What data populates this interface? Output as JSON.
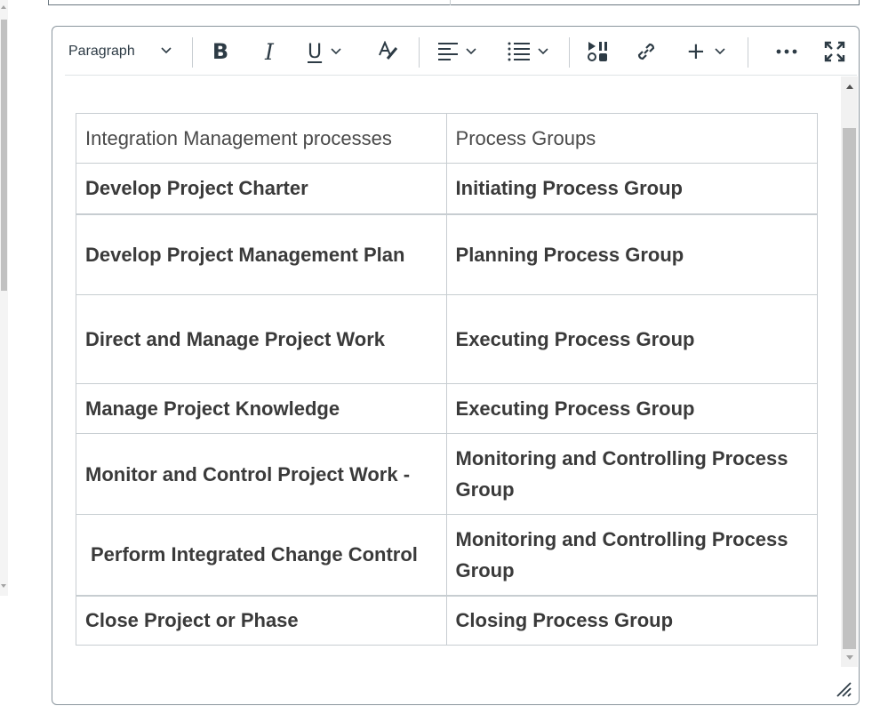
{
  "toolbar": {
    "block_format": "Paragraph",
    "icons": {
      "chevron": "chevron-down-icon",
      "bold": "bold-icon",
      "italic": "italic-icon",
      "underline": "underline-icon",
      "text_color": "text-color-icon",
      "align": "align-left-icon",
      "list": "bulleted-list-icon",
      "media": "media-icon",
      "link": "link-icon",
      "insert": "plus-icon",
      "more": "more-icon",
      "fullscreen": "fullscreen-icon"
    },
    "labels": {
      "bold": "B",
      "italic": "I",
      "underline": "U",
      "plus": "+",
      "more": "•••"
    }
  },
  "table": {
    "header": [
      "Integration Management processes",
      "Process Groups"
    ],
    "rows": [
      [
        "Develop Project Charter",
        "Initiating Process Group"
      ],
      [
        "Develop Project Management Plan",
        "Planning Process Group"
      ],
      [
        "Direct and Manage Project Work",
        "Executing Process Group"
      ],
      [
        "Manage Project Knowledge",
        "Executing Process Group"
      ],
      [
        "Monitor and Control Project Work -",
        "Monitoring and Controlling Process Group"
      ],
      [
        "Perform Integrated Change Control",
        "Monitoring and Controlling Process Group"
      ],
      [
        "Close Project or Phase",
        "Closing Process Group"
      ]
    ]
  },
  "colors": {
    "text": "#2d3b45",
    "border": "#c7cdd1",
    "editor_border": "#8b969e",
    "scrollbar_thumb": "#c1c1c1"
  }
}
